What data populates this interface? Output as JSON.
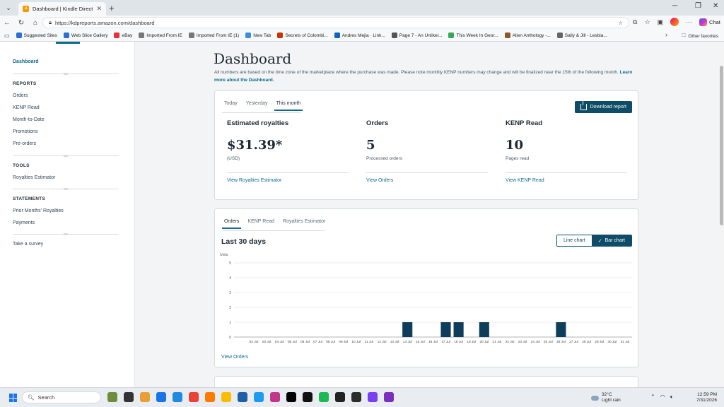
{
  "browser": {
    "tab_title": "Dashboard | Kindle Direct Publish...",
    "url": "https://kdpreports.amazon.com/dashboard",
    "chat_label": "Chat",
    "bookmarks": [
      {
        "label": "Suggested Sites",
        "color": "#2a6fd6"
      },
      {
        "label": "Web Slice Gallery",
        "color": "#2a6fd6"
      },
      {
        "label": "eBay",
        "color": "#e53238"
      },
      {
        "label": "Imported From IE",
        "color": "#777777"
      },
      {
        "label": "Imported From IE (1)",
        "color": "#777777"
      },
      {
        "label": "New Tab",
        "color": "#3b8ede"
      },
      {
        "label": "Secrets of Colombi...",
        "color": "#cc3300"
      },
      {
        "label": "Andres Mejia · Link...",
        "color": "#0a66c2"
      },
      {
        "label": "Page 7 - An Unlikel...",
        "color": "#555555"
      },
      {
        "label": "This Week In Geor...",
        "color": "#34a853"
      },
      {
        "label": "Alien Anthology -...",
        "color": "#8a5a2b"
      },
      {
        "label": "Sally & Jill - Lesbia...",
        "color": "#666666"
      }
    ],
    "other_favorites": "Other favorites"
  },
  "sidebar": {
    "dashboard": "Dashboard",
    "reports_head": "REPORTS",
    "reports": [
      "Orders",
      "KENP Read",
      "Month-to-Date",
      "Promotions",
      "Pre-orders"
    ],
    "tools_head": "TOOLS",
    "tools": [
      "Royalties Estimator"
    ],
    "statements_head": "STATEMENTS",
    "statements": [
      "Prior Months' Royalties",
      "Payments"
    ],
    "survey": "Take a survey"
  },
  "main": {
    "title": "Dashboard",
    "subtitle": "All numbers are based on the time zone of the marketplace where the purchase was made. Please note monthly KENP numbers may change and will be finalized near the 15th of the following month.",
    "subtitle_link": "Learn more about the Dashboard."
  },
  "summary": {
    "tabs": [
      "Today",
      "Yesterday",
      "This month"
    ],
    "selected_tab": 2,
    "download_label": "Download report",
    "metrics": [
      {
        "label": "Estimated royalties",
        "value": "$31.39*",
        "sub": "(USD)",
        "link": "View Royalties Estimator"
      },
      {
        "label": "Orders",
        "value": "5",
        "sub": "Processed orders",
        "link": "View Orders"
      },
      {
        "label": "KENP Read",
        "value": "10",
        "sub": "Pages read",
        "link": "View KENP Read"
      }
    ]
  },
  "chart_section": {
    "tabs": [
      "Orders",
      "KENP Read",
      "Royalties Estimator"
    ],
    "selected_tab": 0,
    "title": "Last 30 days",
    "line_chart_label": "Line chart",
    "bar_chart_label": "Bar chart",
    "view_link": "View Orders"
  },
  "chart_data": {
    "type": "bar",
    "ylabel": "Units",
    "ylim": [
      0,
      5
    ],
    "yticks": [
      0,
      1,
      2,
      3,
      4,
      5
    ],
    "categories": [
      "02 Jul",
      "03 Jul",
      "04 Jul",
      "05 Jul",
      "06 Jul",
      "07 Jul",
      "08 Jul",
      "09 Jul",
      "10 Jul",
      "11 Jul",
      "12 Jul",
      "13 Jul",
      "14 Jul",
      "15 Jul",
      "16 Jul",
      "17 Jul",
      "18 Jul",
      "19 Jul",
      "20 Jul",
      "21 Jul",
      "22 Jul",
      "23 Jul",
      "24 Jul",
      "25 Jul",
      "26 Jul",
      "27 Jul",
      "28 Jul",
      "29 Jul",
      "30 Jul",
      "31 Jul"
    ],
    "values": [
      0,
      0,
      0,
      0,
      0,
      0,
      0,
      0,
      0,
      0,
      0,
      0,
      1,
      0,
      0,
      1,
      1,
      0,
      1,
      0,
      0,
      0,
      0,
      0,
      1,
      0,
      0,
      0,
      0,
      0
    ],
    "bar_color": "#0f3e5c",
    "grid": true
  },
  "taskbar": {
    "search_label": "Search",
    "weather_temp": "32°C",
    "weather_desc": "Light rain",
    "time": "12:59 PM",
    "date": "7/31/2026"
  }
}
